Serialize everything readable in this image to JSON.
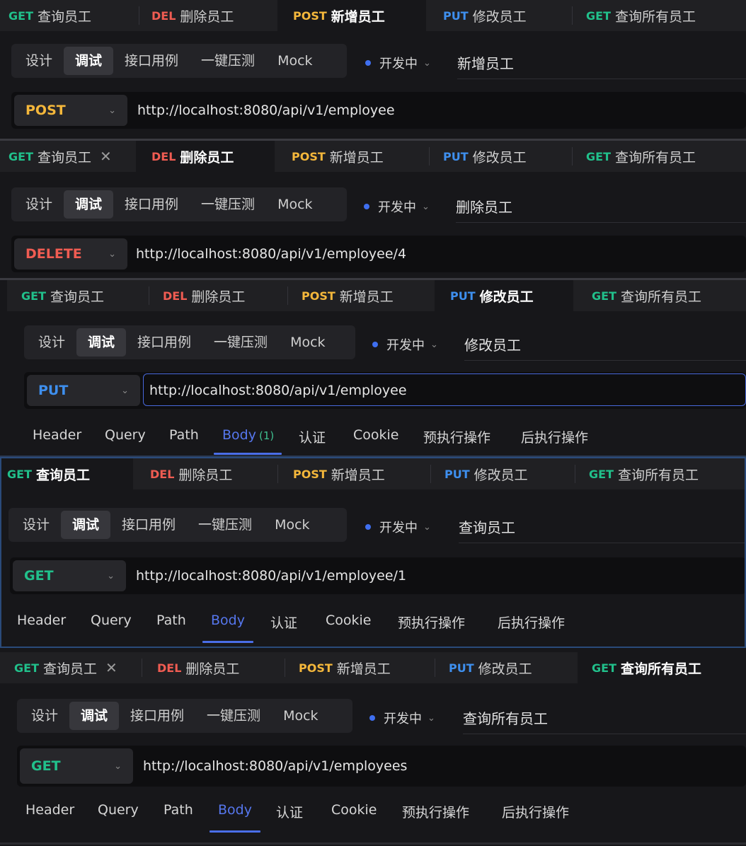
{
  "tabs": [
    {
      "method": "GET",
      "name": "查询员工"
    },
    {
      "method": "DEL",
      "name": "删除员工"
    },
    {
      "method": "POST",
      "name": "新增员工"
    },
    {
      "method": "PUT",
      "name": "修改员工"
    },
    {
      "method": "GET",
      "name": "查询所有员工"
    }
  ],
  "close_glyph": "✕",
  "modes": [
    "设计",
    "调试",
    "接口用例",
    "一键压测",
    "Mock"
  ],
  "status": "开发中",
  "request_tabs": [
    "Header",
    "Query",
    "Path",
    "Body",
    "认证",
    "Cookie",
    "预执行操作",
    "后执行操作"
  ],
  "panels": [
    {
      "title": "新增员工",
      "method": "POST",
      "url": "http://localhost:8080/api/v1/employee"
    },
    {
      "title": "删除员工",
      "method": "DELETE",
      "url": "http://localhost:8080/api/v1/employee/4"
    },
    {
      "title": "修改员工",
      "method": "PUT",
      "url": "http://localhost:8080/api/v1/employee",
      "body_count": "(1)"
    },
    {
      "title": "查询员工",
      "method": "GET",
      "url": "http://localhost:8080/api/v1/employee/1"
    },
    {
      "title": "查询所有员工",
      "method": "GET",
      "url": "http://localhost:8080/api/v1/employees"
    }
  ],
  "colors": {
    "get": "#21c08b",
    "del": "#f05c52",
    "post": "#f4b73b",
    "put": "#3e8fee",
    "accent": "#4a6ee8"
  }
}
